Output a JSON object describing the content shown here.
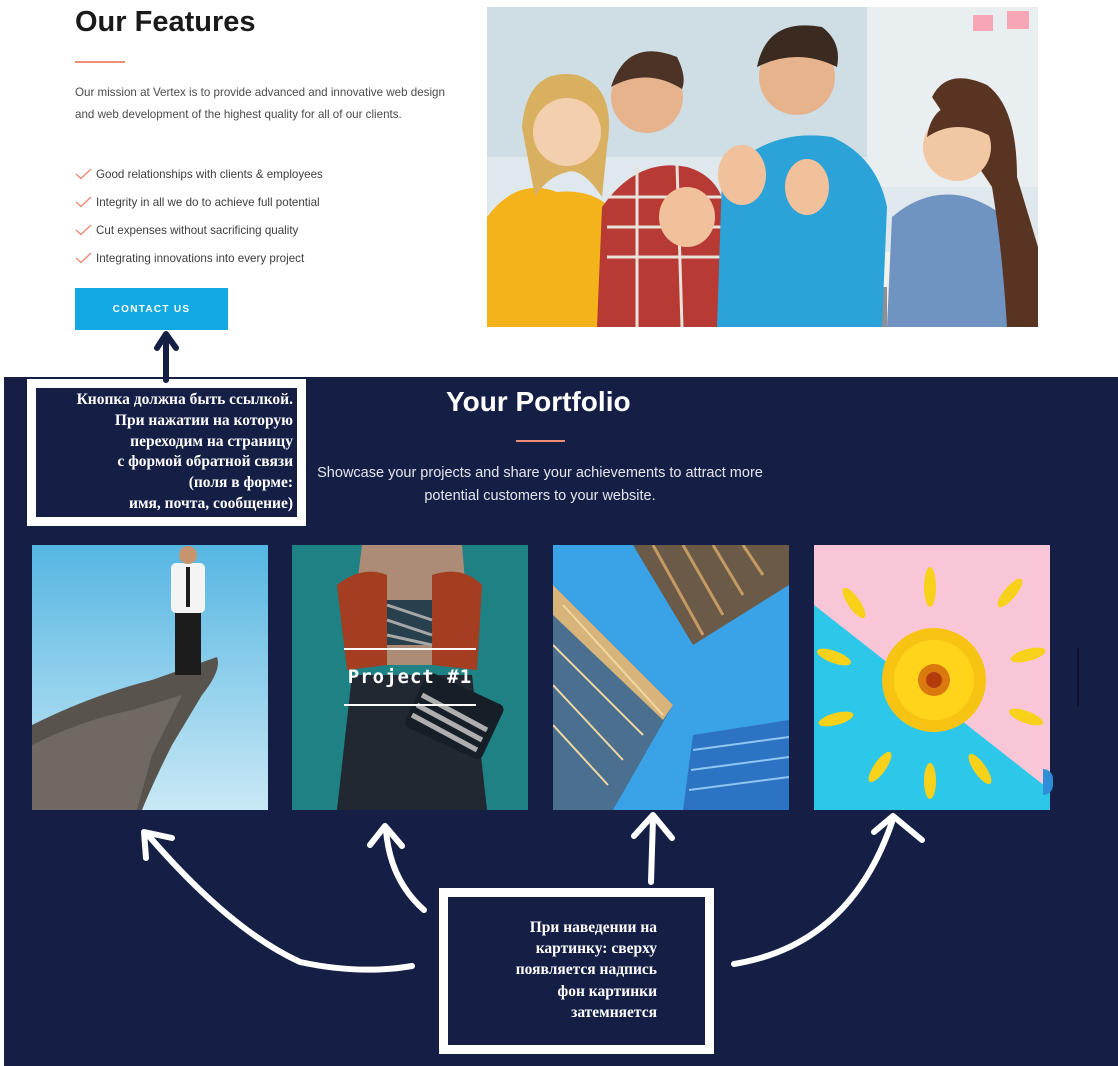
{
  "features": {
    "title": "Our Features",
    "description": "Our mission at Vertex is to provide advanced and innovative web design and web development of the highest quality for all of our clients.",
    "items": [
      {
        "label": "Good relationships with clients & employees"
      },
      {
        "label": "Integrity in all we do to achieve full potential"
      },
      {
        "label": "Cut expenses without sacrificing quality"
      },
      {
        "label": "Integrating innovations into every project"
      }
    ],
    "contact_button": "CONTACT US"
  },
  "portfolio": {
    "title": "Your Portfolio",
    "description": "Showcase your projects and share your achievements to attract more potential customers to your website.",
    "hover_caption": "Project #1"
  },
  "annotations": {
    "button_note": [
      "Кнопка должна быть ссылкой.",
      "При нажатии на которую",
      "переходим на страницу",
      "с формой обратной связи",
      "(поля в форме:",
      "имя, почта, сообщение)"
    ],
    "hover_note": [
      "При наведении на",
      "картинку: сверху",
      "появляется надпись",
      "фон картинки",
      "затемняется"
    ]
  },
  "colors": {
    "accent": "#ee8e79",
    "button": "#11a8e3",
    "portfolio_bg": "#151f45"
  },
  "icons": {
    "list_bullet": "check-icon"
  }
}
